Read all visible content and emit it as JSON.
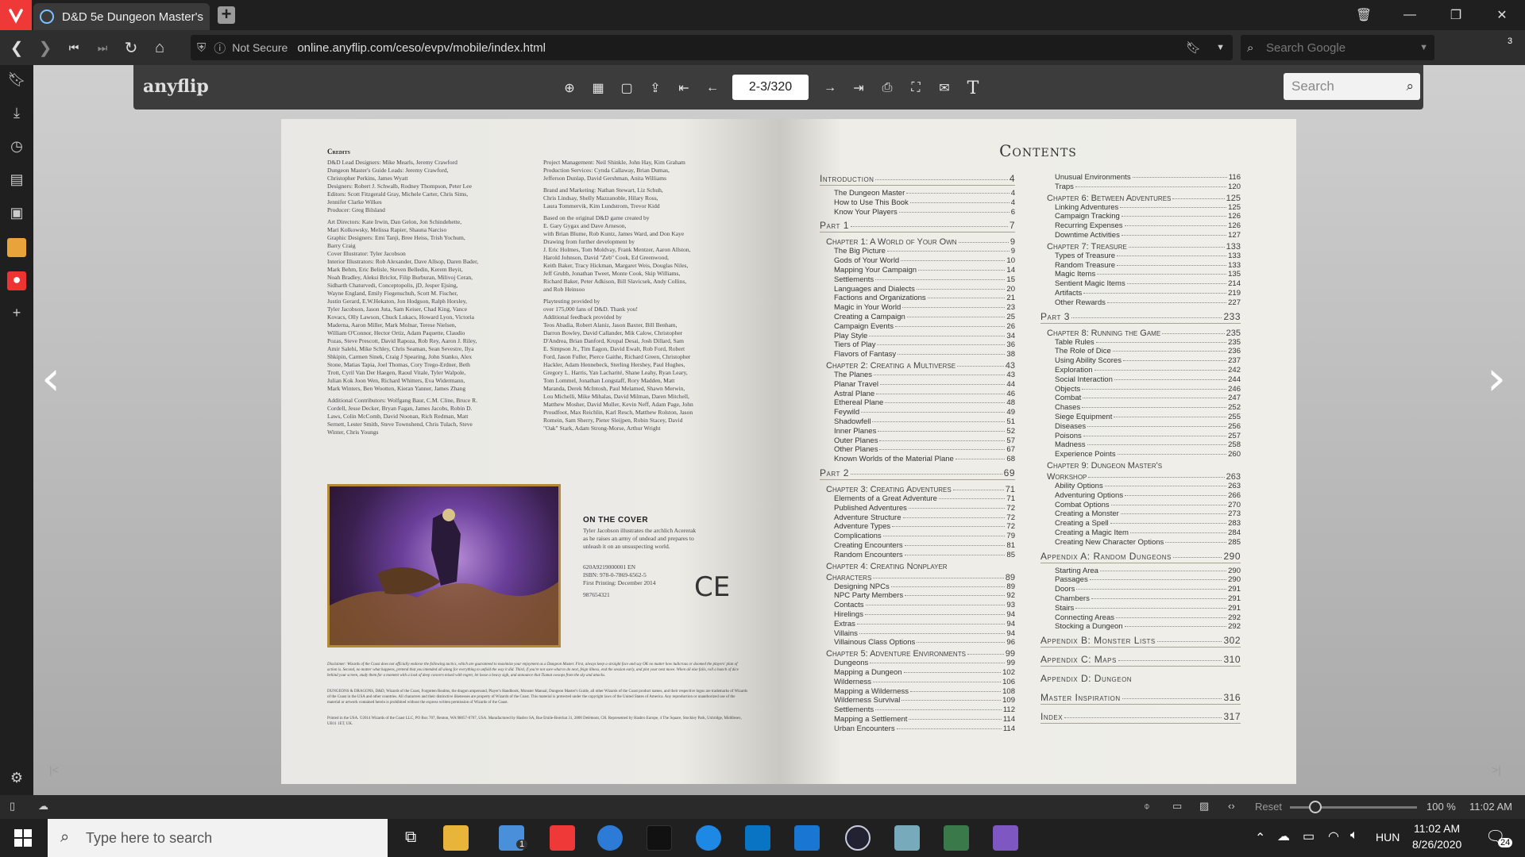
{
  "browser": {
    "tab_title": "D&D 5e Dungeon Master's",
    "not_secure": "Not Secure",
    "url": "online.anyflip.com/ceso/evpv/mobile/index.html",
    "search_placeholder": "Search Google",
    "badge": "3"
  },
  "flip": {
    "logo": "anyflip",
    "page": "2-3/320",
    "search_placeholder": "Search"
  },
  "left_page": {
    "credits_title": "Credits",
    "credits_col1": [
      "D&D Lead Designers: Mike Mearls, Jeremy Crawford",
      "Dungeon Master's Guide Leads: Jeremy Crawford,",
      "Christopher Perkins, James Wyatt",
      "Designers: Robert J. Schwalb, Rodney Thompson, Peter Lee",
      "Editors: Scott Fitzgerald Gray, Michele Carter, Chris Sims,",
      "Jennifer Clarke Wilkes",
      "Producer: Greg Bilsland",
      "",
      "Art Directors: Kate Irwin, Dan Gelon, Jon Schindehette,",
      "Mari Kolkowsky, Melissa Rapier, Shauna Narciso",
      "Graphic Designers: Emi Tanji, Bree Heiss, Trish Yochum,",
      "Barry Craig",
      "Cover Illustrator: Tyler Jacobson",
      "Interior Illustrators: Rob Alexander, Dave Allsop, Daren Bader,",
      "Mark Behm, Eric Belisle, Steven Belledin, Kerem Beyit,",
      "Noah Bradley, Aleksi Briclot, Filip Burburan, Milivoj Ceran,",
      "Sidharth Chaturvedi, Conceptopolis, jD, Jesper Ejsing,",
      "Wayne England, Emily Fiegenschuh, Scott M. Fischer,",
      "Justin Gerard, E.W.Hekaton, Jon Hodgson, Ralph Horsley,",
      "Tyler Jacobson, Jason Juta, Sam Keiser, Chad King, Vance",
      "Kovacs, Olly Lawson, Chuck Lukacs, Howard Lyon, Victoria",
      "Maderna, Aaron Miller, Mark Molnar, Terese Nielsen,",
      "William O'Connor, Hector Ortiz, Adam Paquette, Claudio",
      "Pozas, Steve Prescott, David Rapoza, Rob Rey, Aaron J. Riley,",
      "Amir Salehi, Mike Schley, Chris Seaman, Sean Sevestre, Ilya",
      "Shkipin, Carmen Sinek, Craig J Spearing, John Stanko, Alex",
      "Stone, Matias Tapia, Joel Thomas, Cory Trego-Erdner, Beth",
      "Trott, Cyril Van Der Haegen, Raoul Vitale, Tyler Walpole,",
      "Julian Kok Joon Wen, Richard Whitters, Eva Widermann,",
      "Mark Winters, Ben Wootten, Kieran Yanner, James Zhang",
      "",
      "Additional Contributors: Wolfgang Baur, C.M. Cline, Bruce R.",
      "Cordell, Jesse Decker, Bryan Fagan, James Jacobs, Robin D.",
      "Laws, Colin McComb, David Noonan, Rich Redman, Matt",
      "Sernett, Lester Smith, Steve Townshend, Chris Tulach, Steve",
      "Winter, Chris Youngs"
    ],
    "credits_col2": [
      "Project Management: Neil Shinkle, John Hay, Kim Graham",
      "Production Services: Cynda Callaway, Brian Dumas,",
      "Jefferson Dunlap, David Gershman, Anita Williams",
      "",
      "Brand and Marketing: Nathan Stewart, Liz Schuh,",
      "Chris Lindsay, Shelly Mazzanoble, Hilary Ross,",
      "Laura Tommervik, Kim Lundstrom, Trevor Kidd",
      "",
      "Based on the original D&D game created by",
      "E. Gary Gygax and Dave Arneson,",
      "with Brian Blume, Rob Kuntz, James Ward, and Don Kaye",
      "Drawing from further development by",
      "J. Eric Holmes, Tom Moldvay, Frank Mentzer, Aaron Allston,",
      "Harold Johnson, David \"Zeb\" Cook, Ed Greenwood,",
      "Keith Baker, Tracy Hickman, Margaret Weis, Douglas Niles,",
      "Jeff Grubb, Jonathan Tweet, Monte Cook, Skip Williams,",
      "Richard Baker, Peter Adkison, Bill Slavicsek, Andy Collins,",
      "and Rob Heinsoo",
      "",
      "Playtesting provided by",
      "over 175,000 fans of D&D. Thank you!",
      "Additional feedback provided by",
      "Teos Abadia, Robert Alaniz, Jason Baxter, Bill Benham,",
      "Darron Bowley, David Callander, Mik Calow, Christopher",
      "D'Andrea, Brian Danford, Krupal Desai, Josh Dillard, Sam",
      "E. Simpson Jr., Tim Eagon, David Ewalt, Rob Ford, Robert",
      "Ford, Jason Fuller, Pierce Gaithe, Richard Green, Christopher",
      "Hackler, Adam Hennebeck, Sterling Hershey, Paul Hughes,",
      "Gregory L. Harris, Yan Lacharité, Shane Leahy, Ryan Leary,",
      "Tom Lommel, Jonathan Longstaff, Rory Madden, Matt",
      "Maranda, Derek McIntosh, Paul Melamed, Shawn Merwin,",
      "Lou Michelli, Mike Mihalas, David Milman, Daren Mitchell,",
      "Matthew Mosher, David Muller, Kevin Neff, Adam Page, John",
      "Proudfoot, Max Reichlin, Karl Resch, Matthew Rolston, Jason",
      "Romein, Sam Sherry, Pieter Sleijpen, Robin Stacey, David",
      "\"Oak\" Stark, Adam Strong-Morse, Arthur Wright"
    ],
    "cover_head": "ON THE COVER",
    "cover_text": [
      "Tyler Jacobson illustrates the archlich Acererak",
      "as he raises an army of undead and prepares to",
      "unleash it on an unsuspecting world."
    ],
    "print_info": [
      "620A9219000001 EN",
      "ISBN: 978-0-7869-6562-5",
      "First Printing: December 2014",
      "",
      "987654321"
    ],
    "ce_mark": "CE",
    "disclaimer": "Disclaimer: Wizards of the Coast does not officially endorse the following tactics, which are guaranteed to maximize your enjoyment as a Dungeon Master. First, always keep a straight face and say OK no matter how ludicrous or doomed the players' plan of action is. Second, no matter what happens, pretend that you intended all along for everything to unfold the way it did. Third, if you're not sure what to do next, feign illness, end the session early, and plot your next move. When all else fails, roll a bunch of dice behind your screen, study them for a moment with a look of deep concern mixed with regret, let loose a heavy sigh, and announce that Tiamat swoops from the sky and attacks.",
    "legal": "DUNGEONS & DRAGONS, D&D, Wizards of the Coast, Forgotten Realms, the dragon ampersand, Player's Handbook, Monster Manual, Dungeon Master's Guide, all other Wizards of the Coast product names, and their respective logos are trademarks of Wizards of the Coast in the USA and other countries. All characters and their distinctive likenesses are property of Wizards of the Coast. This material is protected under the copyright laws of the United States of America. Any reproduction or unauthorized use of the material or artwork contained herein is prohibited without the express written permission of Wizards of the Coast.",
    "printed": "Printed in the USA. ©2014 Wizards of the Coast LLC, PO Box 707, Renton, WA 98057-0707, USA. Manufactured by Hasbro SA, Rue Emile-Boéchat 31, 2800 Delémont, CH. Represented by Hasbro Europe, 4 The Square, Stockley Park, Uxbridge, Middlesex, UB11 1ET, UK."
  },
  "contents": {
    "title": "Contents",
    "col1": [
      {
        "t": "head",
        "l": "Introduction",
        "n": "4"
      },
      {
        "t": "item",
        "l": "The Dungeon Master",
        "n": "4"
      },
      {
        "t": "item",
        "l": "How to Use This Book",
        "n": "4"
      },
      {
        "t": "item",
        "l": "Know Your Players",
        "n": "6"
      },
      {
        "t": "head",
        "l": "Part 1",
        "n": "7"
      },
      {
        "t": "ch",
        "l": "Chapter 1: A World of Your Own",
        "n": "9"
      },
      {
        "t": "item",
        "l": "The Big Picture",
        "n": "9"
      },
      {
        "t": "item",
        "l": "Gods of Your World",
        "n": "10"
      },
      {
        "t": "item",
        "l": "Mapping Your Campaign",
        "n": "14"
      },
      {
        "t": "item",
        "l": "Settlements",
        "n": "15"
      },
      {
        "t": "item",
        "l": "Languages and Dialects",
        "n": "20"
      },
      {
        "t": "item",
        "l": "Factions and Organizations",
        "n": "21"
      },
      {
        "t": "item",
        "l": "Magic in Your World",
        "n": "23"
      },
      {
        "t": "item",
        "l": "Creating a Campaign",
        "n": "25"
      },
      {
        "t": "item",
        "l": "Campaign Events",
        "n": "26"
      },
      {
        "t": "item",
        "l": "Play Style",
        "n": "34"
      },
      {
        "t": "item",
        "l": "Tiers of Play",
        "n": "36"
      },
      {
        "t": "item",
        "l": "Flavors of Fantasy",
        "n": "38"
      },
      {
        "t": "ch",
        "l": "Chapter 2: Creating a Multiverse",
        "n": "43"
      },
      {
        "t": "item",
        "l": "The Planes",
        "n": "43"
      },
      {
        "t": "item",
        "l": "Planar Travel",
        "n": "44"
      },
      {
        "t": "item",
        "l": "Astral Plane",
        "n": "46"
      },
      {
        "t": "item",
        "l": "Ethereal Plane",
        "n": "48"
      },
      {
        "t": "item",
        "l": "Feywild",
        "n": "49"
      },
      {
        "t": "item",
        "l": "Shadowfell",
        "n": "51"
      },
      {
        "t": "item",
        "l": "Inner Planes",
        "n": "52"
      },
      {
        "t": "item",
        "l": "Outer Planes",
        "n": "57"
      },
      {
        "t": "item",
        "l": "Other Planes",
        "n": "67"
      },
      {
        "t": "item",
        "l": "Known Worlds of the Material Plane",
        "n": "68"
      },
      {
        "t": "head",
        "l": "Part 2",
        "n": "69"
      },
      {
        "t": "ch",
        "l": "Chapter 3: Creating Adventures",
        "n": "71"
      },
      {
        "t": "item",
        "l": "Elements of a Great Adventure",
        "n": "71"
      },
      {
        "t": "item",
        "l": "Published Adventures",
        "n": "72"
      },
      {
        "t": "item",
        "l": "Adventure Structure",
        "n": "72"
      },
      {
        "t": "item",
        "l": "Adventure Types",
        "n": "72"
      },
      {
        "t": "item",
        "l": "Complications",
        "n": "79"
      },
      {
        "t": "item",
        "l": "Creating Encounters",
        "n": "81"
      },
      {
        "t": "item",
        "l": "Random Encounters",
        "n": "85"
      },
      {
        "t": "ch",
        "l": "Chapter 4: Creating Nonplayer",
        "n": ""
      },
      {
        "t": "ch",
        "l": "Characters",
        "n": "89"
      },
      {
        "t": "item",
        "l": "Designing NPCs",
        "n": "89"
      },
      {
        "t": "item",
        "l": "NPC Party Members",
        "n": "92"
      },
      {
        "t": "item",
        "l": "Contacts",
        "n": "93"
      },
      {
        "t": "item",
        "l": "Hirelings",
        "n": "94"
      },
      {
        "t": "item",
        "l": "Extras",
        "n": "94"
      },
      {
        "t": "item",
        "l": "Villains",
        "n": "94"
      },
      {
        "t": "item",
        "l": "Villainous Class Options",
        "n": "96"
      },
      {
        "t": "ch",
        "l": "Chapter 5: Adventure Environments",
        "n": "99"
      },
      {
        "t": "item",
        "l": "Dungeons",
        "n": "99"
      },
      {
        "t": "item",
        "l": "Mapping a Dungeon",
        "n": "102"
      },
      {
        "t": "item",
        "l": "Wilderness",
        "n": "106"
      },
      {
        "t": "item",
        "l": "Mapping a Wilderness",
        "n": "108"
      },
      {
        "t": "item",
        "l": "Wilderness Survival",
        "n": "109"
      },
      {
        "t": "item",
        "l": "Settlements",
        "n": "112"
      },
      {
        "t": "item",
        "l": "Mapping a Settlement",
        "n": "114"
      },
      {
        "t": "item",
        "l": "Urban Encounters",
        "n": "114"
      }
    ],
    "col2": [
      {
        "t": "item",
        "l": "Unusual Environments",
        "n": "116"
      },
      {
        "t": "item",
        "l": "Traps",
        "n": "120"
      },
      {
        "t": "ch",
        "l": "Chapter 6: Between Adventures",
        "n": "125"
      },
      {
        "t": "item",
        "l": "Linking Adventures",
        "n": "125"
      },
      {
        "t": "item",
        "l": "Campaign Tracking",
        "n": "126"
      },
      {
        "t": "item",
        "l": "Recurring Expenses",
        "n": "126"
      },
      {
        "t": "item",
        "l": "Downtime Activities",
        "n": "127"
      },
      {
        "t": "ch",
        "l": "Chapter 7: Treasure",
        "n": "133"
      },
      {
        "t": "item",
        "l": "Types of Treasure",
        "n": "133"
      },
      {
        "t": "item",
        "l": "Random Treasure",
        "n": "133"
      },
      {
        "t": "item",
        "l": "Magic Items",
        "n": "135"
      },
      {
        "t": "item",
        "l": "Sentient Magic Items",
        "n": "214"
      },
      {
        "t": "item",
        "l": "Artifacts",
        "n": "219"
      },
      {
        "t": "item",
        "l": "Other Rewards",
        "n": "227"
      },
      {
        "t": "head",
        "l": "Part 3",
        "n": "233"
      },
      {
        "t": "ch",
        "l": "Chapter 8: Running the Game",
        "n": "235"
      },
      {
        "t": "item",
        "l": "Table Rules",
        "n": "235"
      },
      {
        "t": "item",
        "l": "The Role of Dice",
        "n": "236"
      },
      {
        "t": "item",
        "l": "Using Ability Scores",
        "n": "237"
      },
      {
        "t": "item",
        "l": "Exploration",
        "n": "242"
      },
      {
        "t": "item",
        "l": "Social Interaction",
        "n": "244"
      },
      {
        "t": "item",
        "l": "Objects",
        "n": "246"
      },
      {
        "t": "item",
        "l": "Combat",
        "n": "247"
      },
      {
        "t": "item",
        "l": "Chases",
        "n": "252"
      },
      {
        "t": "item",
        "l": "Siege Equipment",
        "n": "255"
      },
      {
        "t": "item",
        "l": "Diseases",
        "n": "256"
      },
      {
        "t": "item",
        "l": "Poisons",
        "n": "257"
      },
      {
        "t": "item",
        "l": "Madness",
        "n": "258"
      },
      {
        "t": "item",
        "l": "Experience Points",
        "n": "260"
      },
      {
        "t": "ch",
        "l": "Chapter 9: Dungeon Master's",
        "n": ""
      },
      {
        "t": "ch",
        "l": "Workshop",
        "n": "263"
      },
      {
        "t": "item",
        "l": "Ability Options",
        "n": "263"
      },
      {
        "t": "item",
        "l": "Adventuring Options",
        "n": "266"
      },
      {
        "t": "item",
        "l": "Combat Options",
        "n": "270"
      },
      {
        "t": "item",
        "l": "Creating a Monster",
        "n": "273"
      },
      {
        "t": "item",
        "l": "Creating a Spell",
        "n": "283"
      },
      {
        "t": "item",
        "l": "Creating a Magic Item",
        "n": "284"
      },
      {
        "t": "item",
        "l": "Creating New Character Options",
        "n": "285"
      },
      {
        "t": "head",
        "l": "Appendix A: Random Dungeons",
        "n": "290"
      },
      {
        "t": "item",
        "l": "Starting Area",
        "n": "290"
      },
      {
        "t": "item",
        "l": "Passages",
        "n": "290"
      },
      {
        "t": "item",
        "l": "Doors",
        "n": "291"
      },
      {
        "t": "item",
        "l": "Chambers",
        "n": "291"
      },
      {
        "t": "item",
        "l": "Stairs",
        "n": "291"
      },
      {
        "t": "item",
        "l": "Connecting Areas",
        "n": "292"
      },
      {
        "t": "item",
        "l": "Stocking a Dungeon",
        "n": "292"
      },
      {
        "t": "head",
        "l": "Appendix B: Monster Lists",
        "n": "302"
      },
      {
        "t": "head",
        "l": "Appendix C: Maps",
        "n": "310"
      },
      {
        "t": "head",
        "l": "Appendix D: Dungeon",
        "n": ""
      },
      {
        "t": "head",
        "l": "Master Inspiration",
        "n": "316"
      },
      {
        "t": "head",
        "l": "Index",
        "n": "317"
      }
    ]
  },
  "status": {
    "reset": "Reset",
    "zoom": "100 %",
    "time": "11:02 AM"
  },
  "taskbar": {
    "search_placeholder": "Type here to search",
    "lang": "HUN",
    "clock_time": "11:02 AM",
    "clock_date": "8/26/2020",
    "notif": "24",
    "mail_badge": "1"
  }
}
